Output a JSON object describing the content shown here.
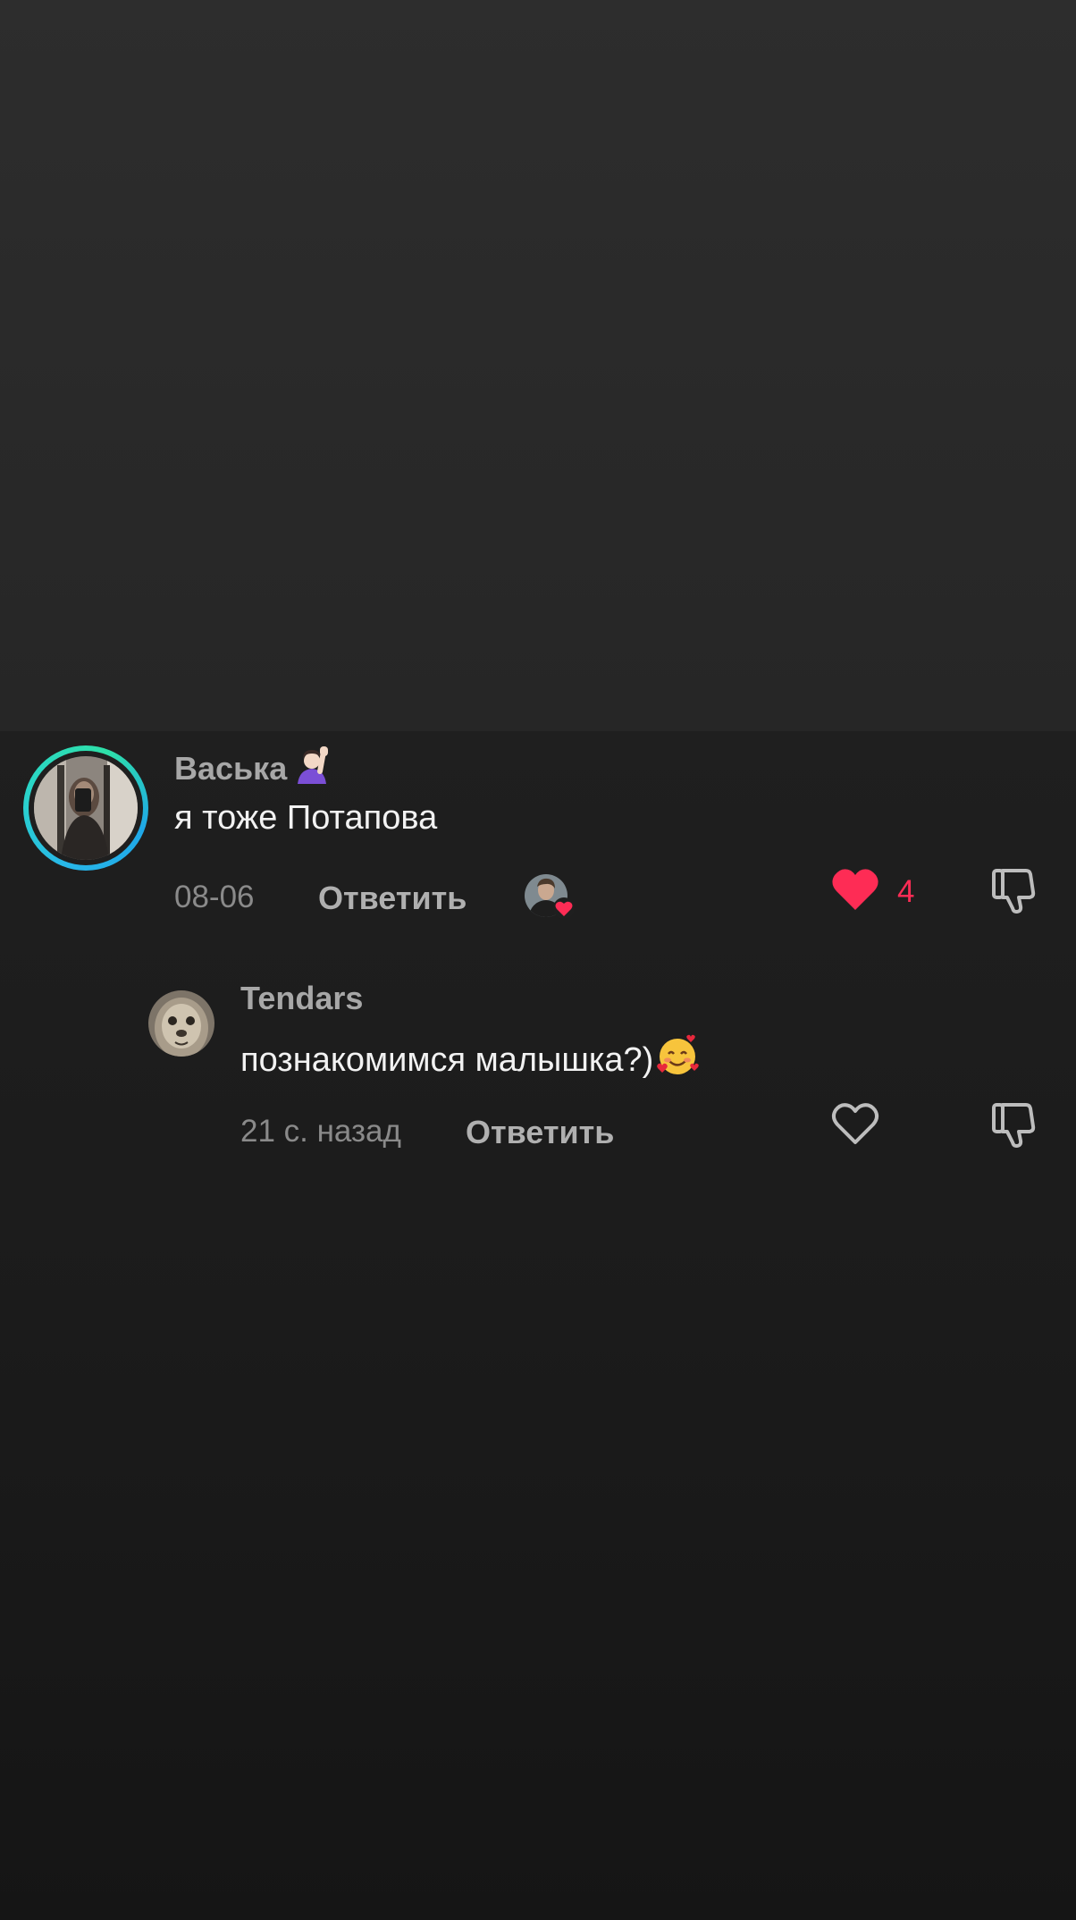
{
  "comments": [
    {
      "username": "Васька",
      "username_emoji": "raising-hand-emoji",
      "text": "я тоже Потапова",
      "time": "08-06",
      "reply_label": "Ответить",
      "liked_by_creator": true,
      "like_count": "4",
      "liked": true
    },
    {
      "username": "Tendars",
      "text": "познакомимся малышка?)",
      "text_emoji": "smiling-face-with-hearts-emoji",
      "time": "21 с. назад",
      "reply_label": "Ответить",
      "liked": false
    }
  ],
  "colors": {
    "like_active": "#fe2c55",
    "ring_start": "#28b7e8",
    "ring_end": "#2ee0a8"
  }
}
